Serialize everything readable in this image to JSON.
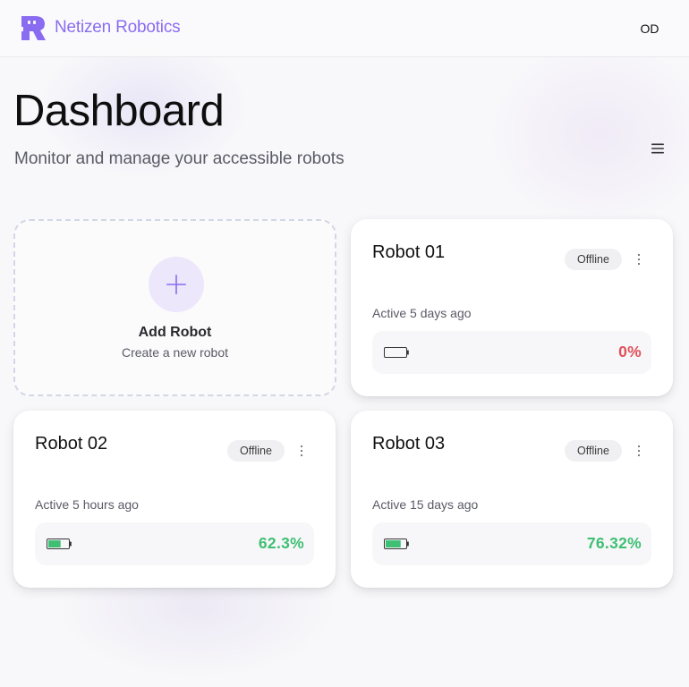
{
  "brand": {
    "name": "Netizen Robotics"
  },
  "user": {
    "initials": "OD"
  },
  "page": {
    "title": "Dashboard",
    "subtitle": "Monitor and manage your accessible robots"
  },
  "add_card": {
    "title": "Add Robot",
    "subtitle": "Create a new robot"
  },
  "colors": {
    "accent": "#8a6cf0",
    "battery_low": "#e0505a",
    "battery_ok": "#3fbf73"
  },
  "robots": [
    {
      "name": "Robot 01",
      "status": "Offline",
      "active": "Active 5 days ago",
      "battery_label": "0%",
      "battery_level": 0,
      "battery_state": "low"
    },
    {
      "name": "Robot 02",
      "status": "Offline",
      "active": "Active 5 hours ago",
      "battery_label": "62.3%",
      "battery_level": 62.3,
      "battery_state": "ok"
    },
    {
      "name": "Robot 03",
      "status": "Offline",
      "active": "Active 15 days ago",
      "battery_label": "76.32%",
      "battery_level": 76.32,
      "battery_state": "ok"
    }
  ]
}
